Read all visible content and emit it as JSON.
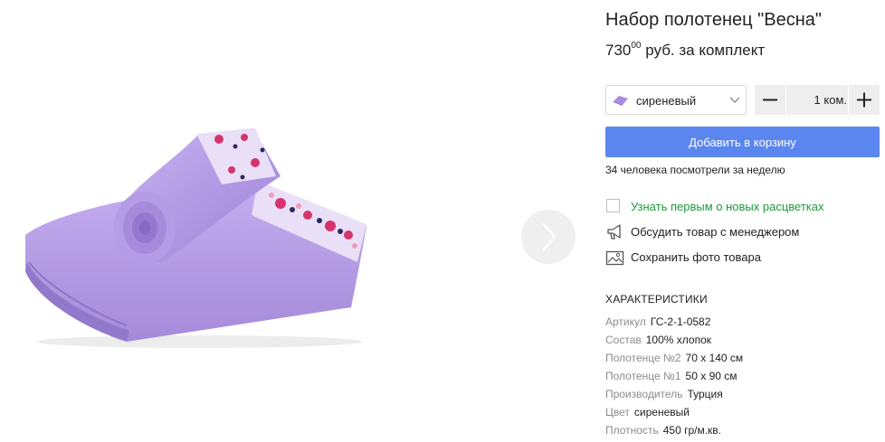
{
  "product": {
    "title": "Набор полотенец \"Весна\"",
    "price_main": "730",
    "price_cents": "00",
    "price_suffix": "руб. за комплект"
  },
  "color_select": {
    "selected": "сиреневый",
    "swatch_color": "#a98ce0"
  },
  "quantity": {
    "value": "1",
    "unit": "ком.",
    "minus_symbol": "−",
    "plus_symbol": "+"
  },
  "add_to_cart_label": "Добавить в корзину",
  "views_text": "34 человека посмотрели за неделю",
  "actions": {
    "notify": "Узнать первым о новых расцветках",
    "discuss": "Обсудить товар с менеджером",
    "save_photo": "Сохранить фото товара"
  },
  "characteristics": {
    "heading": "ХАРАКТЕРИСТИКИ",
    "items": [
      {
        "key": "Артикул",
        "value": "ГС-2-1-0582"
      },
      {
        "key": "Состав",
        "value": "100% хлопок"
      },
      {
        "key": "Полотенце №2",
        "value": "70 х 140 см"
      },
      {
        "key": "Полотенце №1",
        "value": "50 х 90 см"
      },
      {
        "key": "Производитель",
        "value": "Турция"
      },
      {
        "key": "Цвет",
        "value": "сиреневый"
      },
      {
        "key": "Плотность",
        "value": "450 гр/м.кв."
      }
    ]
  },
  "colors": {
    "accent_button": "#5b86f0",
    "notify_link": "#1e9a3a",
    "towel_lilac": "#b79be8",
    "label_gray": "#8c8c8c"
  },
  "icons": {
    "next": "chevron-right-icon",
    "select_arrow": "chevron-down-icon",
    "notify": "checkbox-icon",
    "discuss": "megaphone-icon",
    "save": "image-icon"
  }
}
